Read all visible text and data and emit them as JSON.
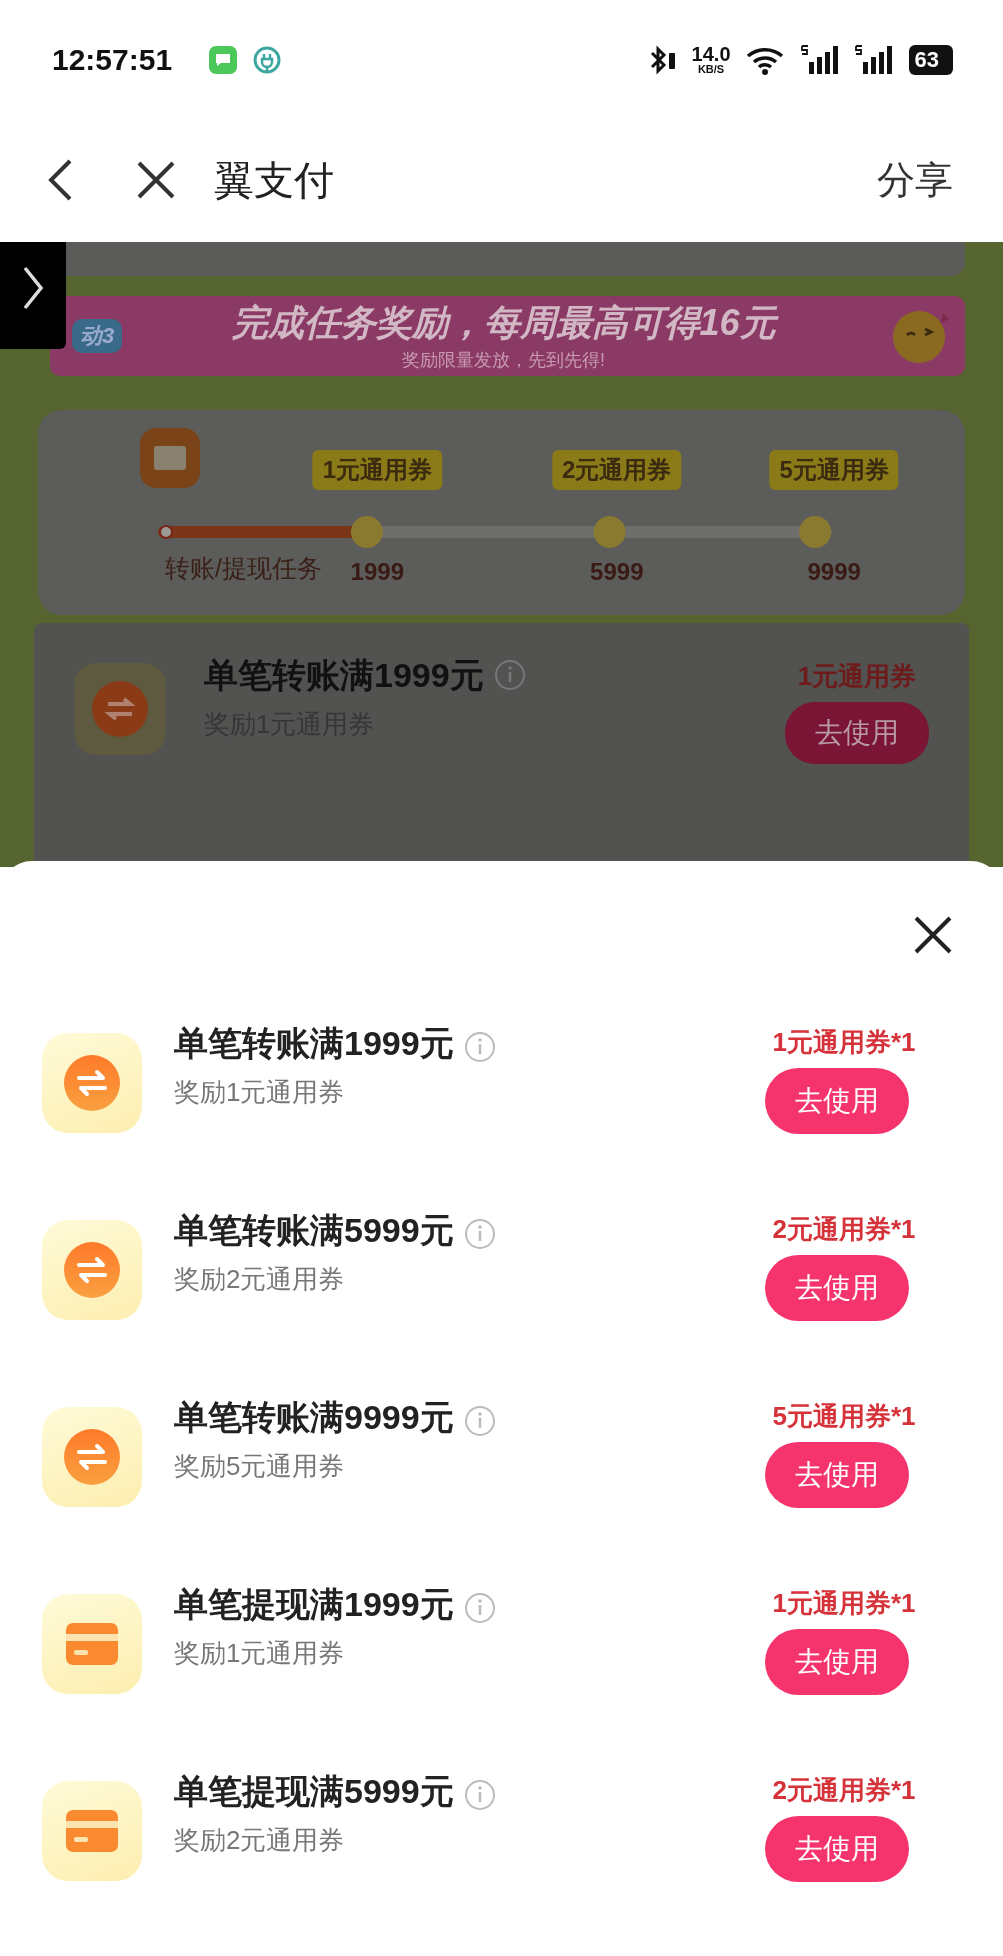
{
  "status_bar": {
    "time": "12:57:51",
    "network_speed": "14.0",
    "speed_unit": "KB/S",
    "battery": "63"
  },
  "nav": {
    "title": "翼支付",
    "share": "分享"
  },
  "background": {
    "banner": {
      "badge": "动3",
      "title": "完成任务奖励，每周最高可得16元",
      "subtitle": "奖励限量发放，先到先得!"
    },
    "progress": {
      "label": "转账/提现任务",
      "level": 0.32,
      "milestones": [
        {
          "reward": "1元通用券",
          "amount": "1999"
        },
        {
          "reward": "2元通用券",
          "amount": "5999"
        },
        {
          "reward": "5元通用券",
          "amount": "9999"
        }
      ]
    },
    "task": {
      "kind": "transfer",
      "title": "单笔转账满1999元",
      "subtitle": "奖励1元通用券",
      "reward": "1元通用券",
      "button": "去使用"
    }
  },
  "sheet": {
    "rows": [
      {
        "kind": "transfer",
        "title": "单笔转账满1999元",
        "subtitle": "奖励1元通用券",
        "reward": "1元通用券*1",
        "button": "去使用"
      },
      {
        "kind": "transfer",
        "title": "单笔转账满5999元",
        "subtitle": "奖励2元通用券",
        "reward": "2元通用券*1",
        "button": "去使用"
      },
      {
        "kind": "transfer",
        "title": "单笔转账满9999元",
        "subtitle": "奖励5元通用券",
        "reward": "5元通用券*1",
        "button": "去使用"
      },
      {
        "kind": "withdraw",
        "title": "单笔提现满1999元",
        "subtitle": "奖励1元通用券",
        "reward": "1元通用券*1",
        "button": "去使用"
      },
      {
        "kind": "withdraw",
        "title": "单笔提现满5999元",
        "subtitle": "奖励2元通用券",
        "reward": "2元通用券*1",
        "button": "去使用"
      }
    ]
  }
}
